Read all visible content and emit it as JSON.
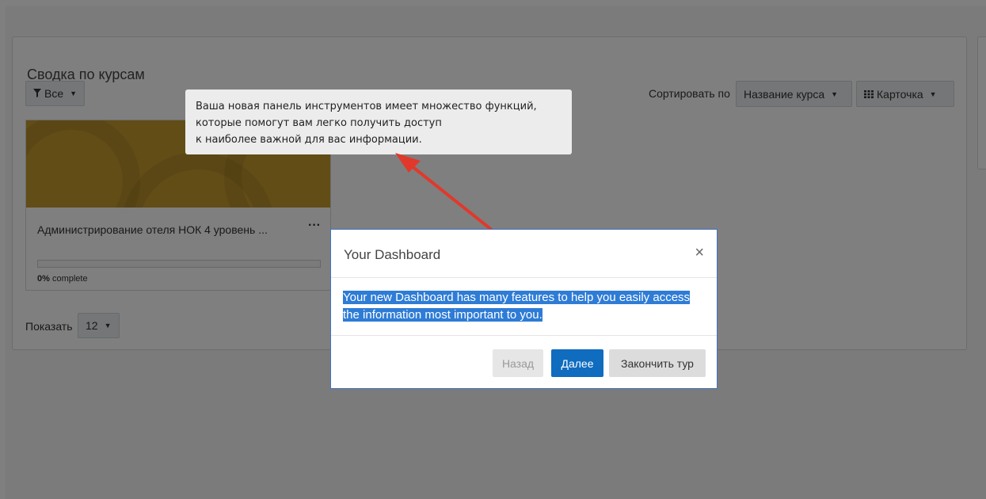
{
  "block": {
    "title": "Сводка по курсам",
    "filter_label": "Все",
    "sort_label": "Сортировать по",
    "sort_value": "Название курса",
    "view_value": "Карточка",
    "show_label": "Показать",
    "show_value": "12"
  },
  "course": {
    "name": "Администрирование отеля НОК 4 уровень ...",
    "progress_fraction": 0,
    "progress_percent": "0%",
    "progress_suffix": " complete",
    "image_color": "#c49a2e"
  },
  "tooltip": {
    "line1": "Ваша новая панель инструментов имеет множество функций,",
    "line2": "которые помогут вам легко получить доступ",
    "line3": "к наиболее важной для вас информации."
  },
  "modal": {
    "title": "Your Dashboard",
    "close_glyph": "×",
    "body": "Your new Dashboard has many features to help you easily access the information most important to you.",
    "back_label": "Назад",
    "next_label": "Далее",
    "end_label": "Закончить тур"
  },
  "icons": {
    "filter": "filter-icon",
    "grid": "grid-icon",
    "caret": "caret-down-icon",
    "ellipsis": "ellipsis-icon"
  },
  "colors": {
    "primary": "#0f6cbf",
    "selection": "#2e7cd6",
    "arrow": "#e0392b",
    "overlay": "rgba(0,0,0,0.5)"
  }
}
